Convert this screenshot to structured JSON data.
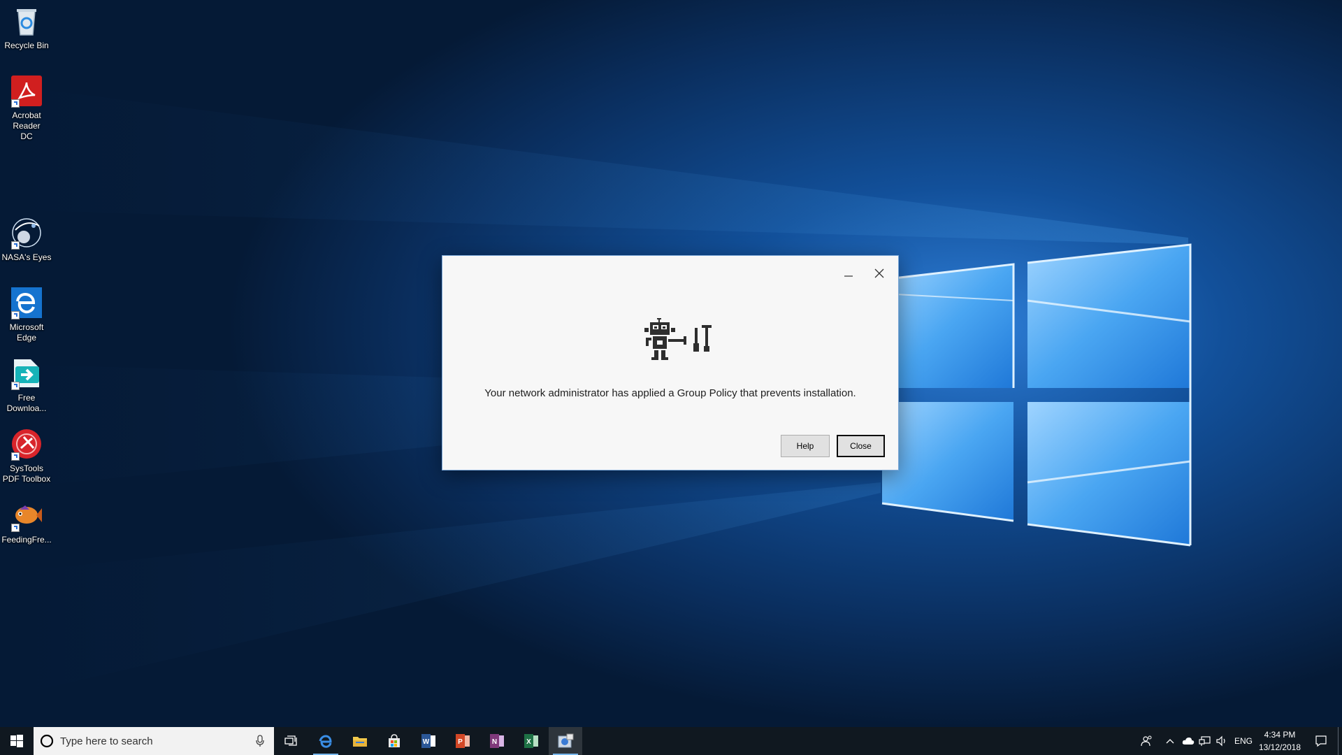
{
  "desktop": {
    "icons": [
      {
        "label": "Recycle Bin",
        "icon": "recycle-bin-icon"
      },
      {
        "label": "Acrobat Reader DC",
        "icon": "acrobat-reader-icon"
      },
      {
        "label": "NASA's Eyes",
        "icon": "nasa-eyes-icon"
      },
      {
        "label": "Microsoft Edge",
        "icon": "edge-icon"
      },
      {
        "label": "Free Downloa...",
        "icon": "free-download-icon"
      },
      {
        "label": "SysTools PDF Toolbox",
        "icon": "systools-pdf-icon"
      },
      {
        "label": "FeedingFre...",
        "icon": "fish-icon"
      }
    ]
  },
  "dialog": {
    "message": "Your network administrator has applied a Group Policy that prevents installation.",
    "help_label": "Help",
    "close_label": "Close",
    "icon": "robot-tools-icon"
  },
  "taskbar": {
    "search_placeholder": "Type here to search",
    "apps": [
      "start",
      "task-view",
      "edge",
      "file-explorer",
      "store",
      "word",
      "powerpoint",
      "onenote",
      "excel",
      "installer"
    ],
    "tray": {
      "language": "ENG",
      "time": "4:34 PM",
      "date": "13/12/2018"
    }
  },
  "colors": {
    "desktop_bg": "#06203f",
    "taskbar_bg": "#101820",
    "accent": "#78b8ee"
  }
}
